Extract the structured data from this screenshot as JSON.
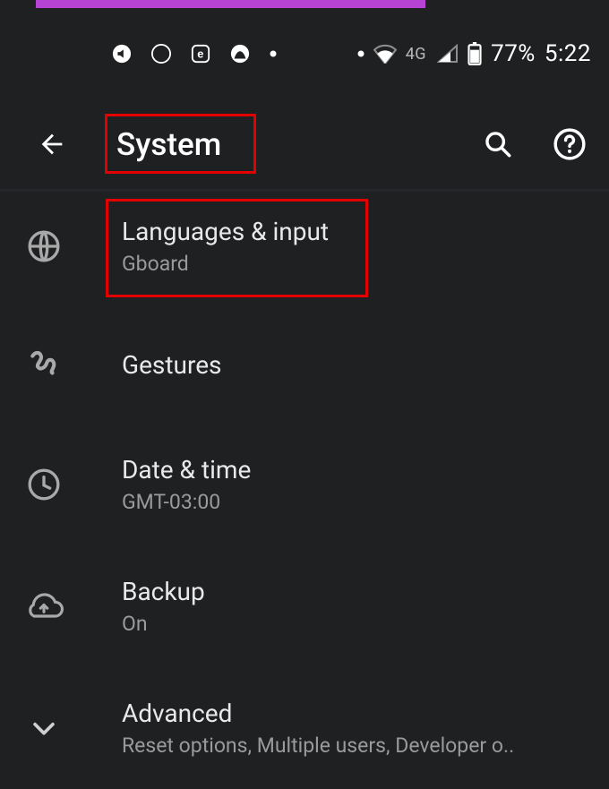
{
  "statusbar": {
    "network_label": "4G",
    "battery_text": "77%",
    "clock": "5:22"
  },
  "header": {
    "title": "System"
  },
  "items": {
    "languages": {
      "title": "Languages & input",
      "subtitle": "Gboard"
    },
    "gestures": {
      "title": "Gestures"
    },
    "datetime": {
      "title": "Date & time",
      "subtitle": "GMT-03:00"
    },
    "backup": {
      "title": "Backup",
      "subtitle": "On"
    },
    "advanced": {
      "title": "Advanced",
      "subtitle": "Reset options, Multiple users, Developer o.."
    }
  }
}
